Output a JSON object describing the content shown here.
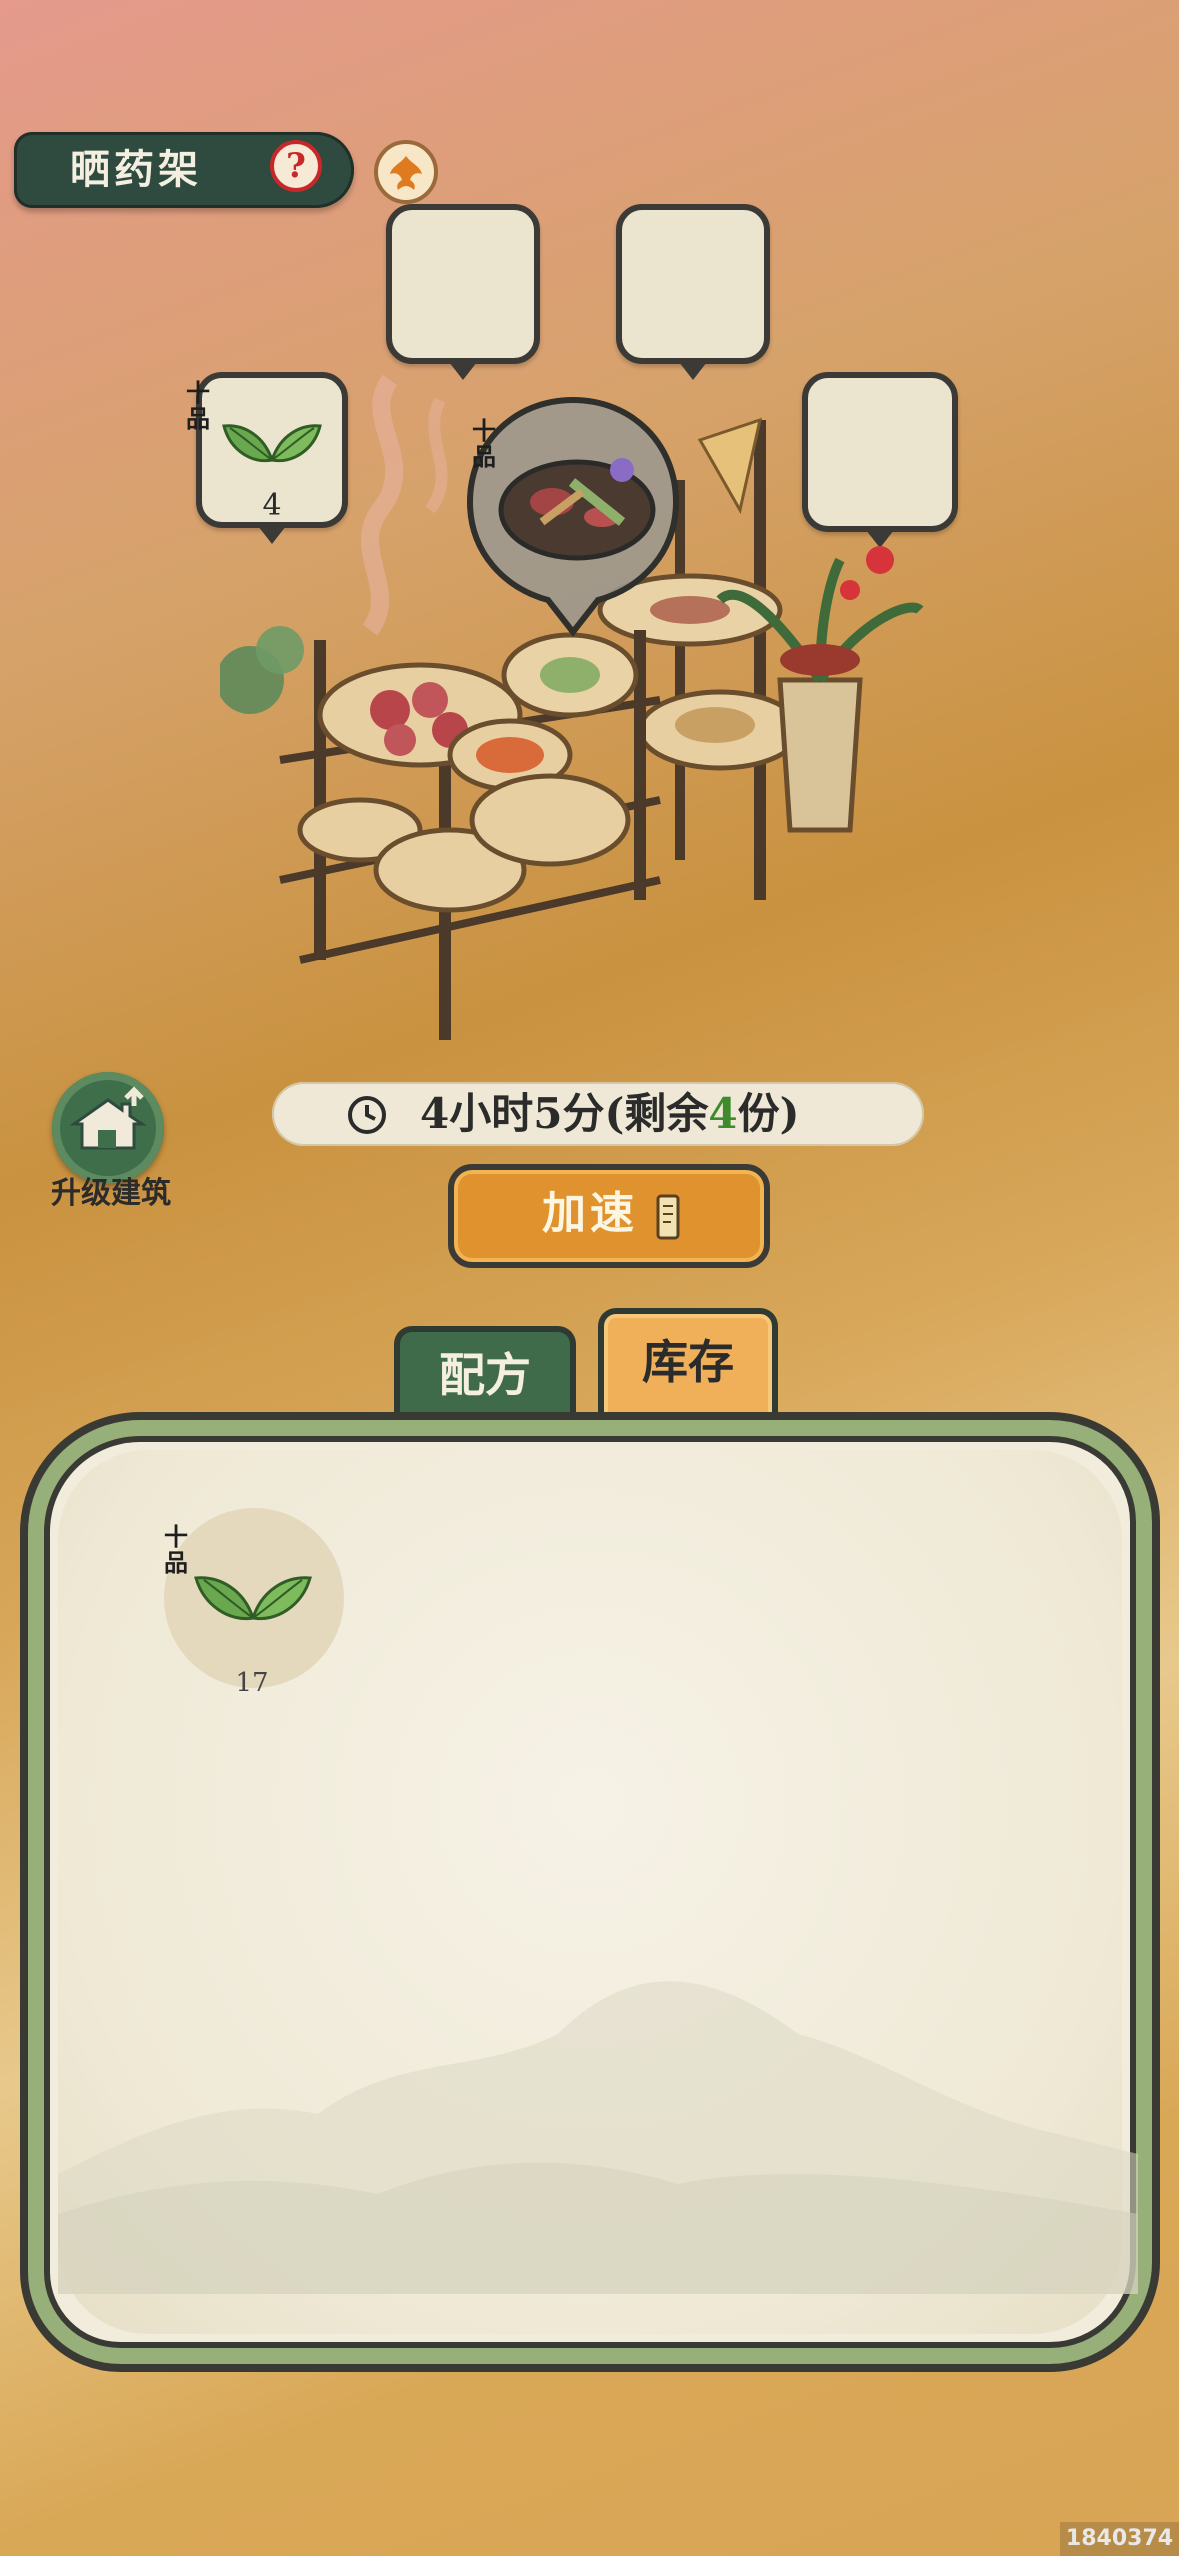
{
  "header": {
    "title": "晒药架",
    "help_icon": "?",
    "phoenix_icon": "phoenix-emblem"
  },
  "slots": [
    {
      "grade": "十品",
      "item_icon": "green-leaf",
      "count": "4"
    },
    {
      "grade": "",
      "item_icon": "",
      "count": ""
    },
    {
      "grade": "",
      "item_icon": "",
      "count": ""
    },
    {
      "grade": "",
      "item_icon": "",
      "count": ""
    }
  ],
  "active_production": {
    "grade": "十品",
    "item_icon": "mixed-herb-bowl"
  },
  "timer": {
    "prefix": "4小时5分(剩余",
    "remaining": "4",
    "suffix": "份)"
  },
  "upgrade": {
    "label": "升级建筑"
  },
  "speed_up": {
    "label": "加速",
    "icon": "scroll-icon"
  },
  "tabs": [
    {
      "label": "配方",
      "active": true
    },
    {
      "label": "库存",
      "active": false
    }
  ],
  "recipe_items": [
    {
      "grade": "十品",
      "icon": "green-leaf",
      "count": "17"
    }
  ],
  "watermark": "1840374",
  "colors": {
    "dark_green": "#2f4a3f",
    "orange": "#e0922e",
    "panel_bg": "#f1ecdb",
    "panel_border_green": "#97b07a",
    "highlight_green": "#3e8a2c"
  }
}
